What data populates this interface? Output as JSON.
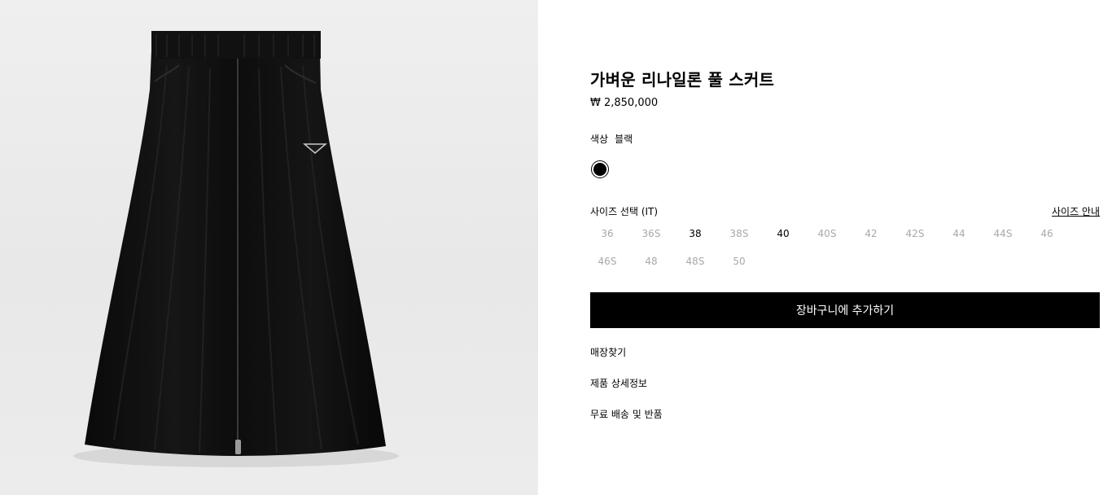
{
  "product": {
    "title": "가벼운 리나일론 풀 스커트",
    "price": "₩ 2,850,000",
    "color_label": "색상",
    "color_value": "블랙",
    "swatch_color": "#000000"
  },
  "sizes": {
    "label": "사이즈 선택 (IT)",
    "guide_label": "사이즈 안내",
    "row1": [
      "36",
      "36S",
      "38",
      "38S",
      "40",
      "40S",
      "42",
      "42S",
      "44",
      "44S",
      "46"
    ],
    "row2": [
      "46S",
      "48",
      "48S",
      "50"
    ],
    "available": [
      "38",
      "40"
    ]
  },
  "actions": {
    "add_to_cart": "장바구니에 추가하기",
    "find_store": "매장찾기",
    "details": "제품 상세정보",
    "shipping": "무료 배송 및 반품"
  },
  "colors": {
    "button_bg": "#000000",
    "unavailable_text": "#a8a8a8"
  }
}
